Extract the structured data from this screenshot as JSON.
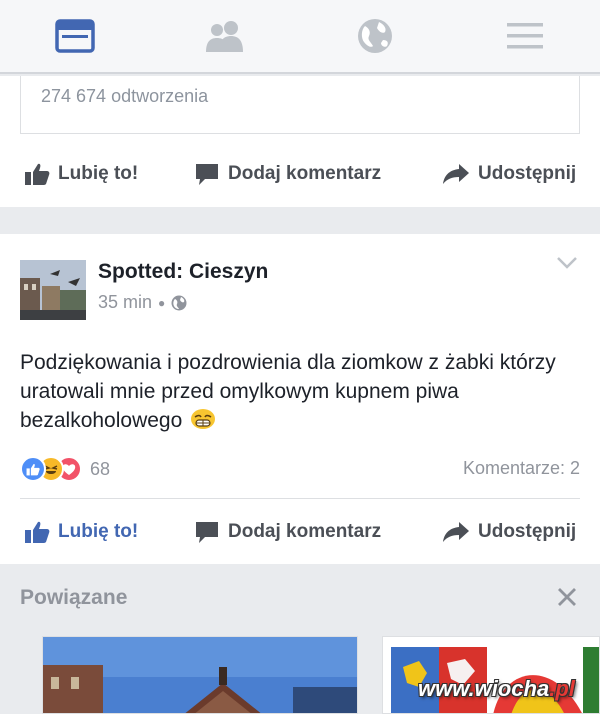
{
  "nav": {
    "tabs": [
      {
        "icon": "news-feed-icon",
        "active": true
      },
      {
        "icon": "friends-icon",
        "active": false
      },
      {
        "icon": "globe-icon",
        "active": false
      },
      {
        "icon": "menu-icon",
        "active": false
      }
    ]
  },
  "previous_post": {
    "views": "274 674 odtworzenia",
    "actions": {
      "like": "Lubię to!",
      "comment": "Dodaj komentarz",
      "share": "Udostępnij"
    }
  },
  "post": {
    "page_name": "Spotted: Cieszyn",
    "time": "35 min",
    "text": "Podziękowania i pozdrowienia dla ziomkow z żabki którzy uratowali mnie przed omylkowym kupnem piwa bezalkoholowego",
    "reaction_count": "68",
    "comments": "Komentarze: 2",
    "actions": {
      "like": "Lubię to!",
      "comment": "Dodaj komentarz",
      "share": "Udostępnij"
    },
    "liked": true
  },
  "related": {
    "title": "Powiązane"
  },
  "watermark": {
    "main": "www.wiocha",
    "accent": ".pl"
  },
  "colors": {
    "brand": "#4267b2",
    "background": "#e9ebee",
    "muted": "#90949c"
  }
}
